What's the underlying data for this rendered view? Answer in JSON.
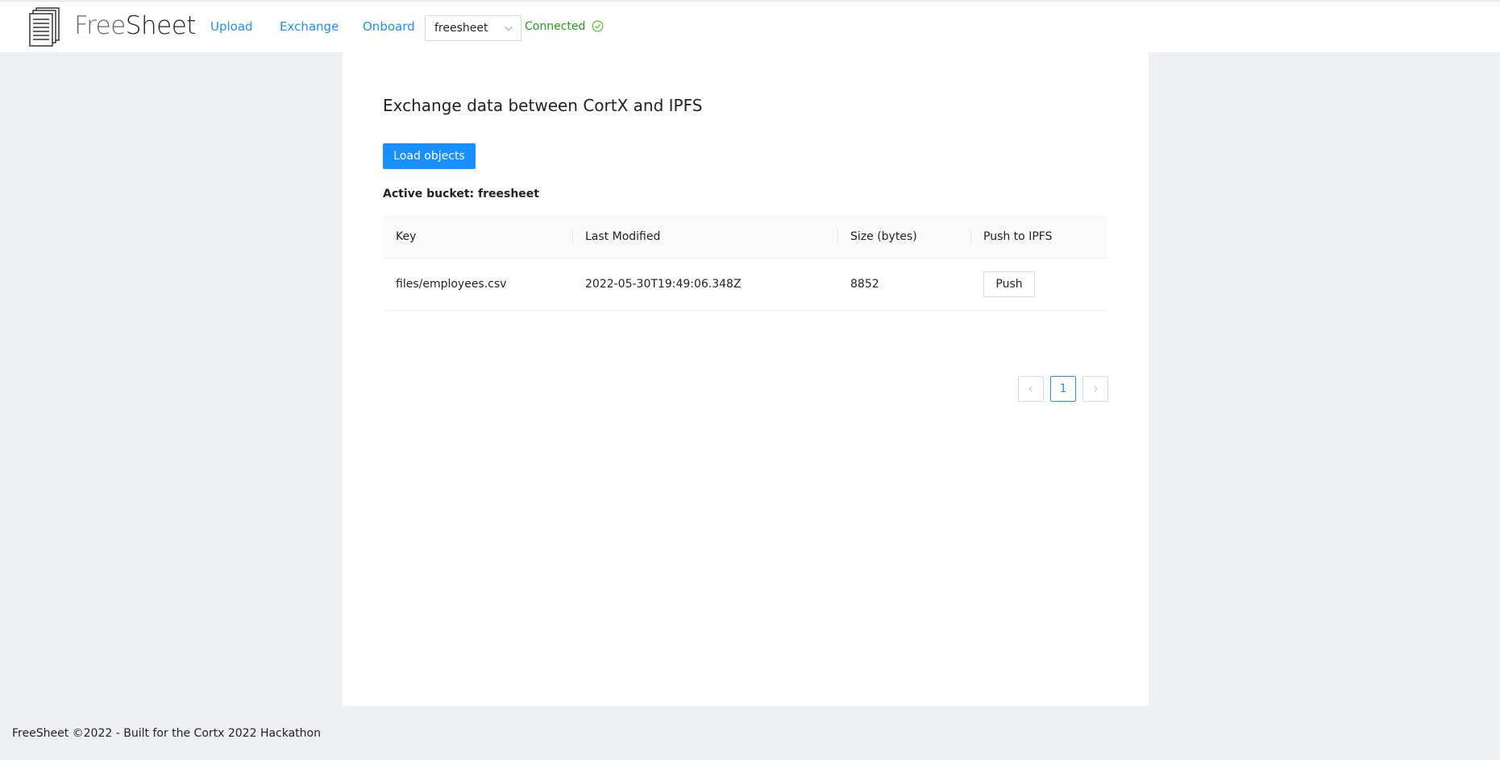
{
  "header": {
    "brand_light": "Free",
    "brand_dark": "Sheet",
    "nav": [
      "Upload",
      "Exchange",
      "Onboard"
    ],
    "bucket_select": "freesheet",
    "status": "Connected"
  },
  "main": {
    "title": "Exchange data between CortX and IPFS",
    "load_button": "Load objects",
    "active_bucket": "Active bucket: freesheet",
    "table": {
      "columns": [
        "Key",
        "Last Modified",
        "Size (bytes)",
        "Push to IPFS"
      ],
      "rows": [
        {
          "key": "files/employees.csv",
          "last_modified": "2022-05-30T19:49:06.348Z",
          "size": "8852",
          "action": "Push"
        }
      ]
    },
    "pagination": {
      "current_page": "1"
    }
  },
  "footer": {
    "text": "FreeSheet ©2022 - Built for the Cortx 2022 Hackathon"
  },
  "colors": {
    "accent": "#1890ff",
    "status": "#1f9d1f",
    "background": "#eff0f4"
  }
}
